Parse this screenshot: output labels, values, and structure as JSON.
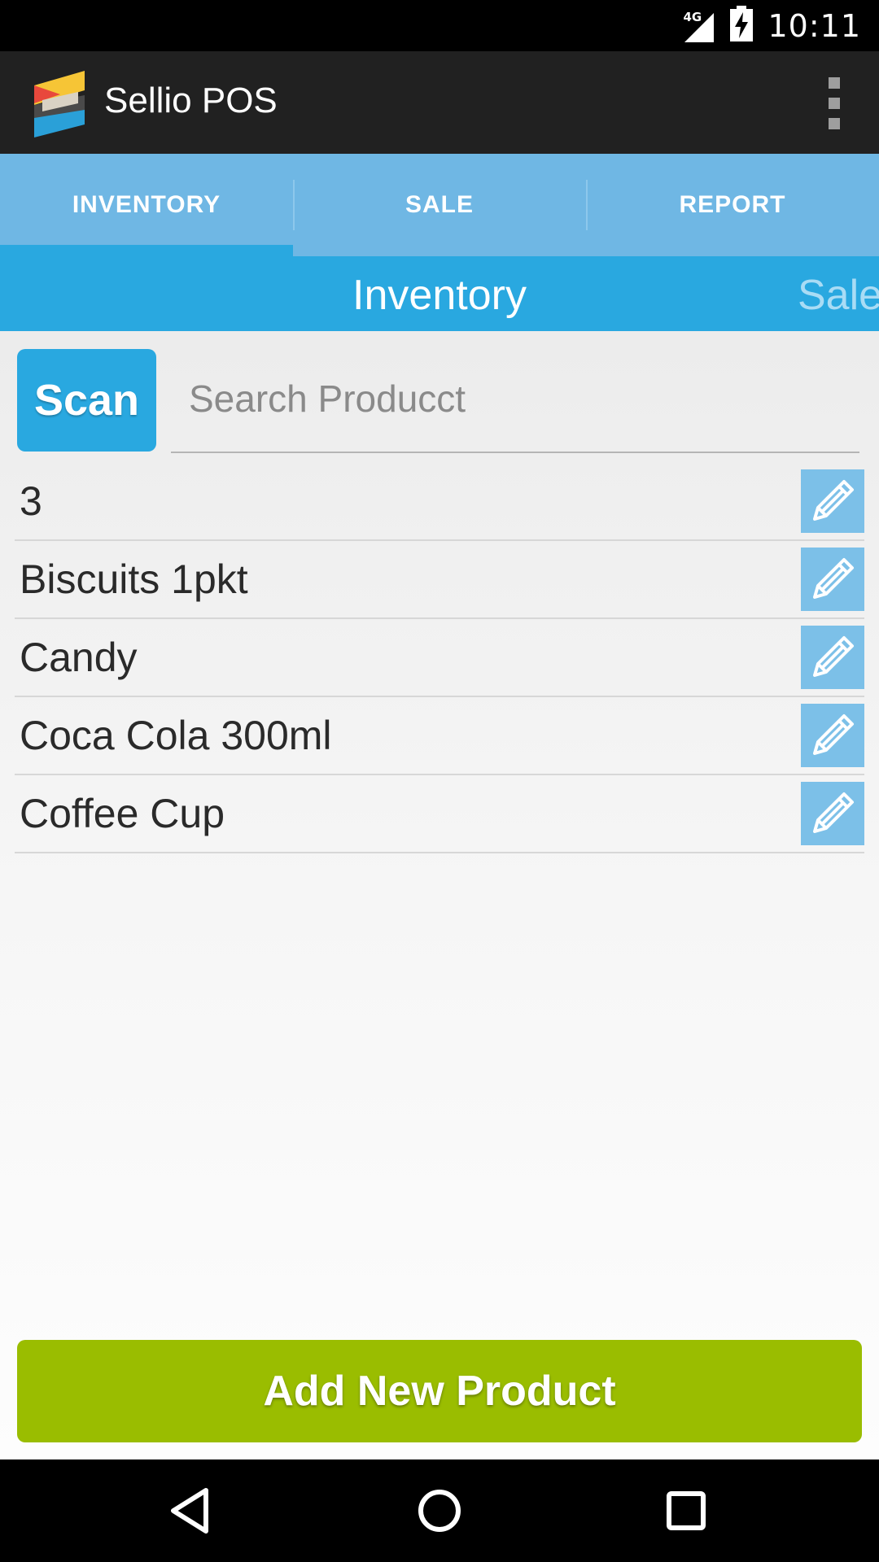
{
  "status_bar": {
    "network": "4G",
    "time": "10:11"
  },
  "app_bar": {
    "title": "Sellio POS",
    "logo_icon": "sellio-logo",
    "overflow_icon": "more-vert-icon"
  },
  "tabs": [
    {
      "label": "INVENTORY",
      "active": true
    },
    {
      "label": "SALE",
      "active": false
    },
    {
      "label": "REPORT",
      "active": false
    }
  ],
  "pager": {
    "current": "Inventory",
    "next": "Sale"
  },
  "search": {
    "scan_label": "Scan",
    "placeholder": "Search Producct",
    "value": ""
  },
  "products": [
    {
      "name": "3"
    },
    {
      "name": "Biscuits 1pkt"
    },
    {
      "name": "Candy"
    },
    {
      "name": "Coca Cola 300ml"
    },
    {
      "name": "Coffee Cup"
    }
  ],
  "add_button_label": "Add New Product",
  "colors": {
    "accent_blue": "#29a8e0",
    "tab_blue": "#6fb7e4",
    "edit_blue": "#7cc0e8",
    "add_green": "#9abd00",
    "app_bar": "#212121"
  },
  "nav_bar": [
    "back-icon",
    "home-icon",
    "recents-icon"
  ]
}
